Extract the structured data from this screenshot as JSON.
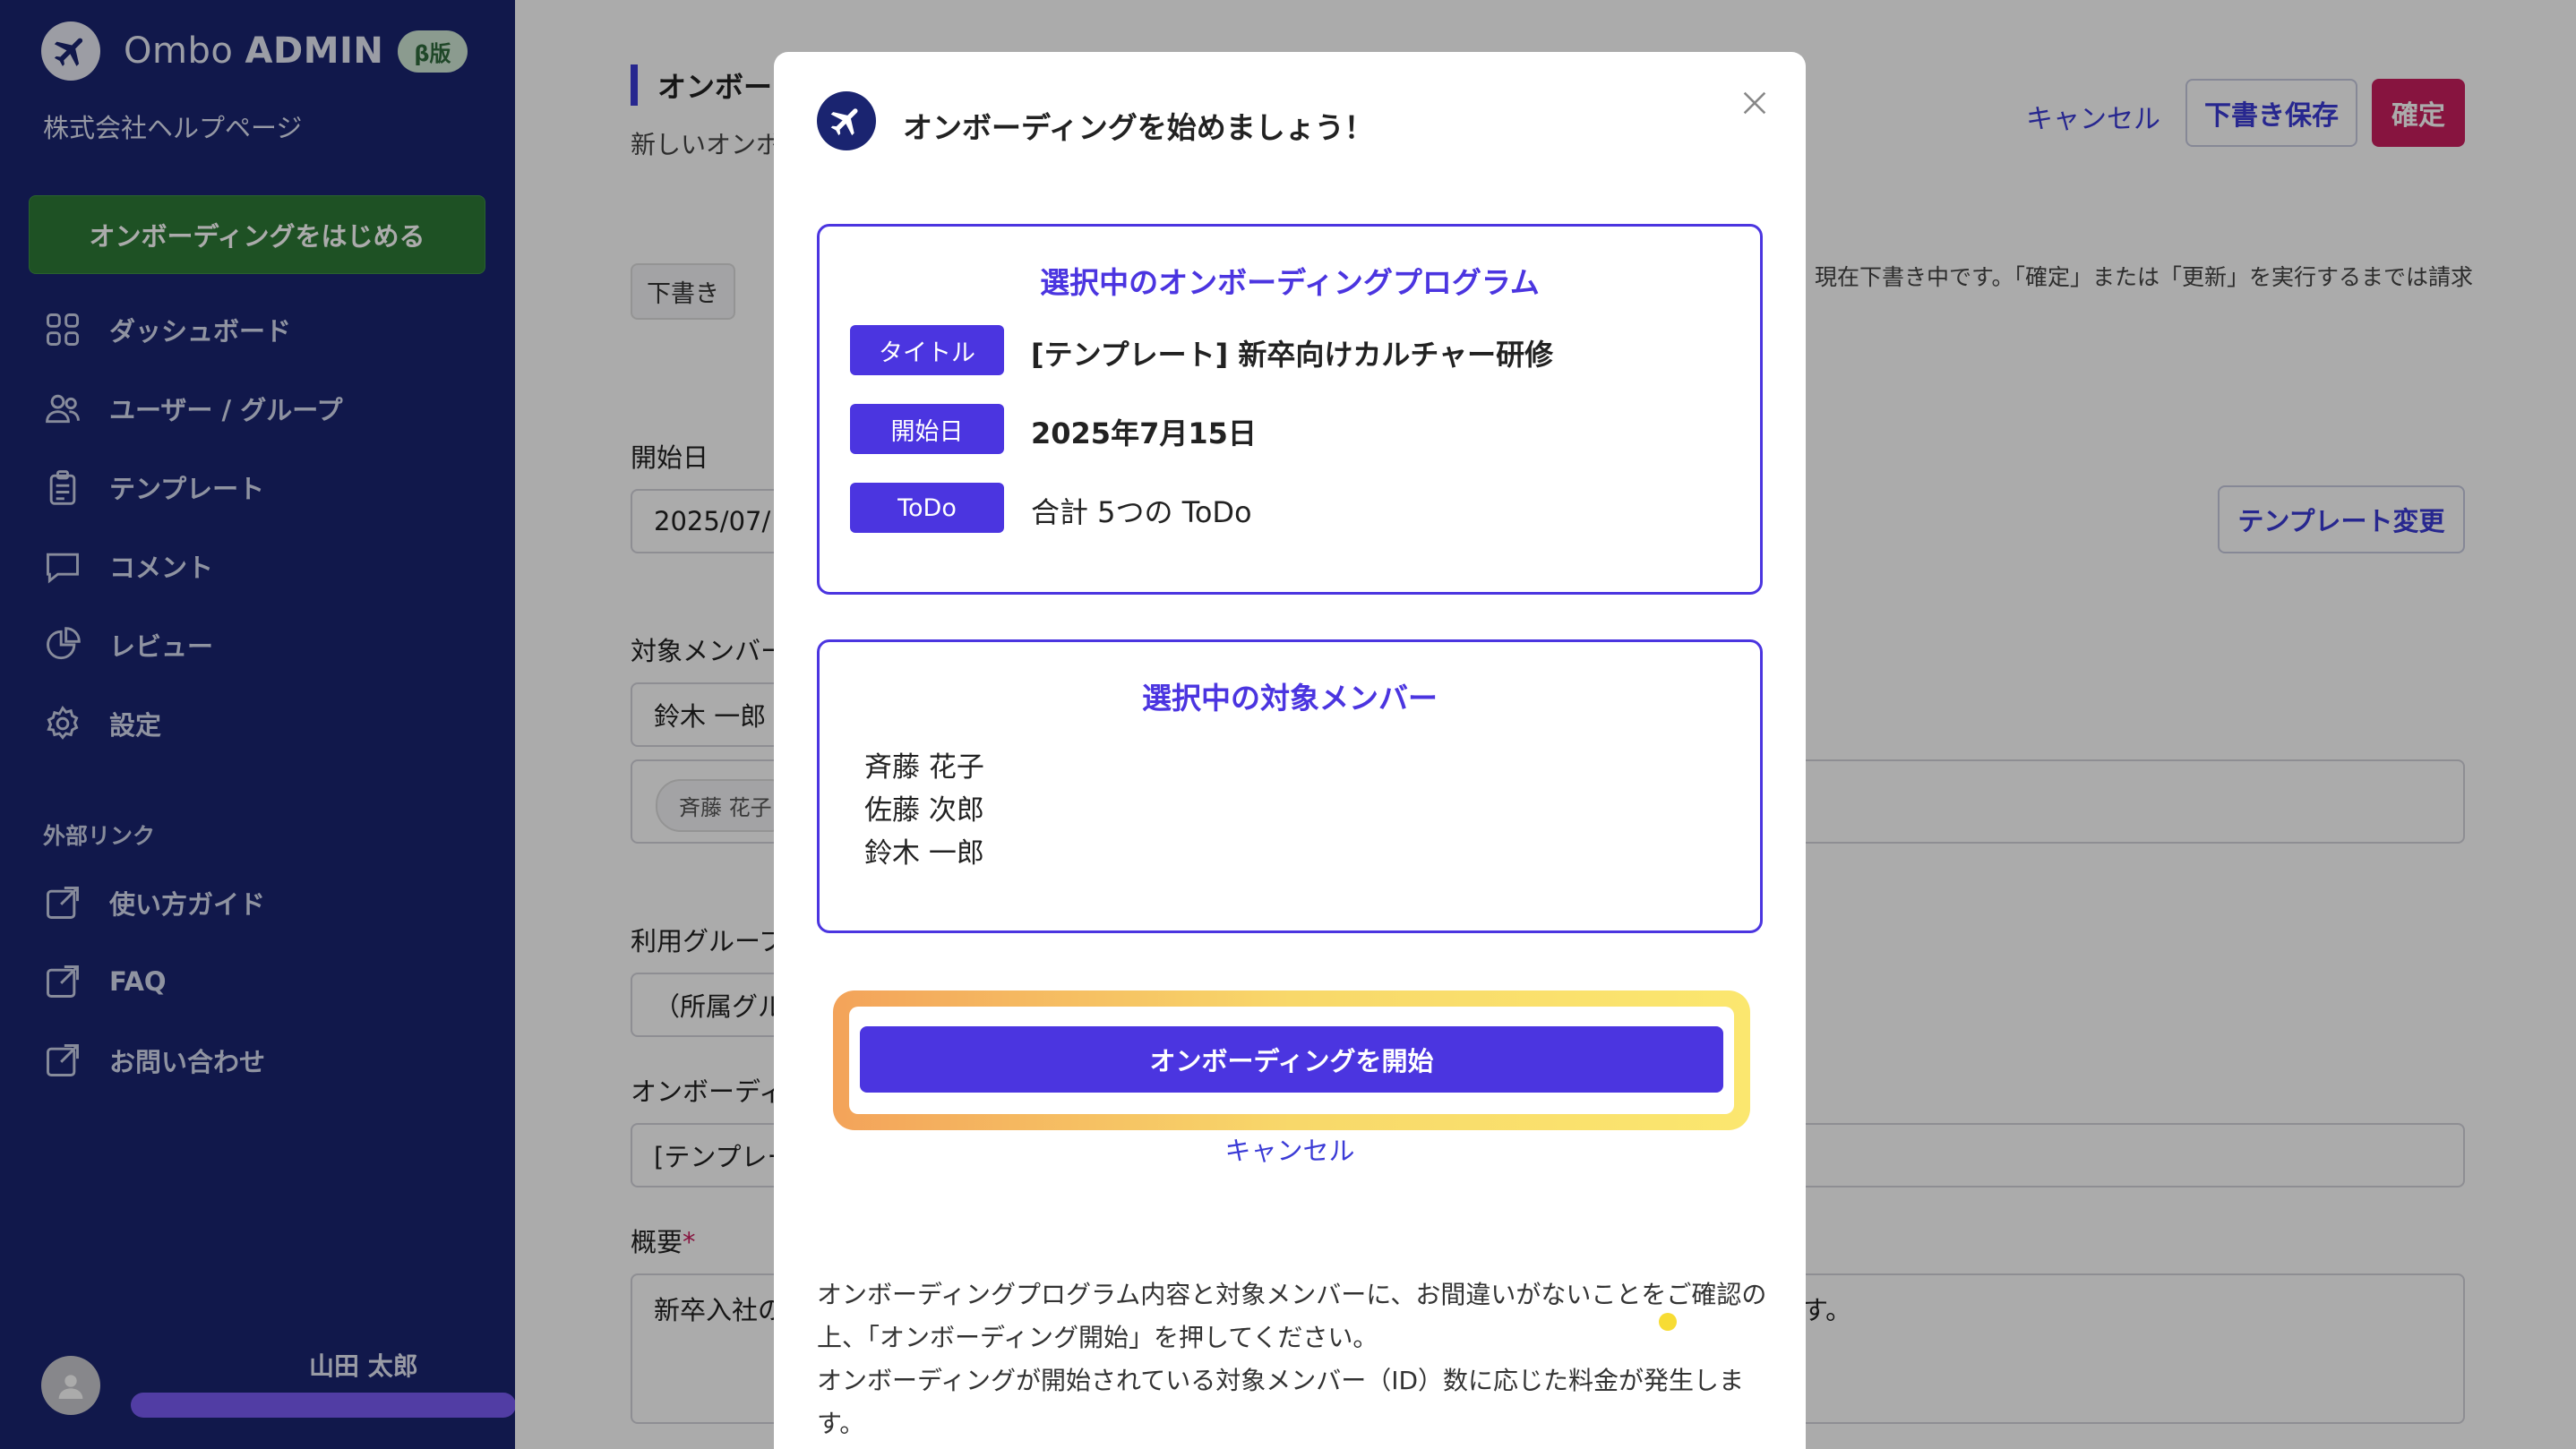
{
  "sidebar": {
    "brand": {
      "name_light": "Ombo ",
      "name_bold": "ADMIN",
      "beta": "β版"
    },
    "company": "株式会社ヘルプページ",
    "start_button": "オンボーディングをはじめる",
    "nav": [
      {
        "label": "ダッシュボード",
        "icon": "grid-icon"
      },
      {
        "label": "ユーザー / グループ",
        "icon": "users-icon"
      },
      {
        "label": "テンプレート",
        "icon": "clipboard-icon"
      },
      {
        "label": "コメント",
        "icon": "chat-icon"
      },
      {
        "label": "レビュー",
        "icon": "pie-chart-icon"
      },
      {
        "label": "設定",
        "icon": "gear-icon"
      }
    ],
    "external_title": "外部リンク",
    "external": [
      {
        "label": "使い方ガイド",
        "icon": "external-link-icon"
      },
      {
        "label": "FAQ",
        "icon": "external-link-icon"
      },
      {
        "label": "お問い合わせ",
        "icon": "external-link-icon"
      }
    ],
    "user_name": "山田 太郎"
  },
  "main": {
    "title": "オンボーデ",
    "subtitle": "新しいオンボ",
    "draft_tag": "下書き",
    "notice": "現在下書き中です。「確定」または「更新」を実行するまでは請求",
    "top_cancel": "キャンセル",
    "top_save": "下書き保存",
    "top_confirm": "確定",
    "start_date_label": "開始日",
    "start_date_value": "2025/07/",
    "template_change": "テンプレート変更",
    "members_label": "対象メンバー",
    "members_value": "鈴木 一郎",
    "member_chip": "斉藤 花子",
    "group_label": "利用グループ",
    "group_value": "（所属グル",
    "onboarding_label": "オンボーディ",
    "onboarding_value": "[テンプレー",
    "overview_label": "概要",
    "overview_required": "*",
    "overview_value_left": "新卒入社の",
    "overview_value_right": "す。"
  },
  "modal": {
    "title": "オンボーディングを始めましょう！",
    "program_box_title": "選択中のオンボーディングプログラム",
    "rows": [
      {
        "badge": "タイトル",
        "value": "[テンプレート] 新卒向けカルチャー研修",
        "bold": true
      },
      {
        "badge": "開始日",
        "value": "2025年7月15日",
        "bold": true
      },
      {
        "badge": "ToDo",
        "value": "合計 5つの ToDo",
        "bold": false
      }
    ],
    "members_box_title": "選択中の対象メンバー",
    "members": [
      "斉藤 花子",
      "佐藤 次郎",
      "鈴木 一郎"
    ],
    "start_button": "オンボーディングを開始",
    "cancel": "キャンセル",
    "note_line1": "オンボーディングプログラム内容と対象メンバーに、お間違いがないことをご確認の上、「オンボーディング開始」を押してください。",
    "note_line2": "オンボーディングが開始されている対象メンバー（ID）数に応じた料金が発生します。"
  },
  "colors": {
    "sidebar_bg": "#1a2470",
    "accent": "#4b35e0",
    "confirm": "#c91e5e",
    "start_green": "#2e7a36"
  }
}
